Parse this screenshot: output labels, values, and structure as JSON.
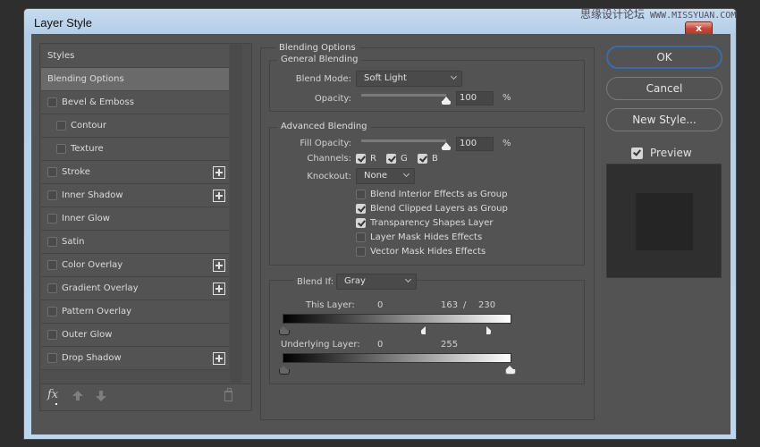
{
  "window": {
    "title": "Layer Style",
    "watermark": "思缘设计论坛",
    "watermark_url": "WWW.MISSYUAN.COM",
    "close_label": "x"
  },
  "styles_list": {
    "items": [
      {
        "label": "Styles",
        "checkbox": false,
        "checked": false,
        "indent": false,
        "plus": false,
        "selected": false
      },
      {
        "label": "Blending Options",
        "checkbox": false,
        "checked": false,
        "indent": false,
        "plus": false,
        "selected": true
      },
      {
        "label": "Bevel & Emboss",
        "checkbox": true,
        "checked": false,
        "indent": false,
        "plus": false,
        "selected": false
      },
      {
        "label": "Contour",
        "checkbox": true,
        "checked": false,
        "indent": true,
        "plus": false,
        "selected": false
      },
      {
        "label": "Texture",
        "checkbox": true,
        "checked": false,
        "indent": true,
        "plus": false,
        "selected": false
      },
      {
        "label": "Stroke",
        "checkbox": true,
        "checked": false,
        "indent": false,
        "plus": true,
        "selected": false
      },
      {
        "label": "Inner Shadow",
        "checkbox": true,
        "checked": false,
        "indent": false,
        "plus": true,
        "selected": false
      },
      {
        "label": "Inner Glow",
        "checkbox": true,
        "checked": false,
        "indent": false,
        "plus": false,
        "selected": false
      },
      {
        "label": "Satin",
        "checkbox": true,
        "checked": false,
        "indent": false,
        "plus": false,
        "selected": false
      },
      {
        "label": "Color Overlay",
        "checkbox": true,
        "checked": false,
        "indent": false,
        "plus": true,
        "selected": false
      },
      {
        "label": "Gradient Overlay",
        "checkbox": true,
        "checked": false,
        "indent": false,
        "plus": true,
        "selected": false
      },
      {
        "label": "Pattern Overlay",
        "checkbox": true,
        "checked": false,
        "indent": false,
        "plus": false,
        "selected": false
      },
      {
        "label": "Outer Glow",
        "checkbox": true,
        "checked": false,
        "indent": false,
        "plus": false,
        "selected": false
      },
      {
        "label": "Drop Shadow",
        "checkbox": true,
        "checked": false,
        "indent": false,
        "plus": true,
        "selected": false
      }
    ],
    "footer": {
      "fx_label": "fx"
    }
  },
  "blending_options": {
    "title": "Blending Options",
    "general": {
      "title": "General Blending",
      "blend_mode_label": "Blend Mode:",
      "blend_mode_value": "Soft Light",
      "opacity_label": "Opacity:",
      "opacity_value": "100",
      "opacity_percent": 100,
      "unit": "%"
    },
    "advanced": {
      "title": "Advanced Blending",
      "fill_opacity_label": "Fill Opacity:",
      "fill_opacity_value": "100",
      "fill_opacity_percent": 100,
      "unit": "%",
      "channels_label": "Channels:",
      "channels": [
        {
          "label": "R",
          "checked": true
        },
        {
          "label": "G",
          "checked": true
        },
        {
          "label": "B",
          "checked": true
        }
      ],
      "knockout_label": "Knockout:",
      "knockout_value": "None",
      "options": [
        {
          "label": "Blend Interior Effects as Group",
          "checked": false
        },
        {
          "label": "Blend Clipped Layers as Group",
          "checked": true
        },
        {
          "label": "Transparency Shapes Layer",
          "checked": true
        },
        {
          "label": "Layer Mask Hides Effects",
          "checked": false
        },
        {
          "label": "Vector Mask Hides Effects",
          "checked": false
        }
      ]
    },
    "blend_if": {
      "label": "Blend If:",
      "value": "Gray",
      "this_layer": {
        "label": "This Layer:",
        "low": "0",
        "high_split_a": "163",
        "separator": "/",
        "high_split_b": "230"
      },
      "underlying_layer": {
        "label": "Underlying Layer:",
        "low": "0",
        "high": "255"
      }
    }
  },
  "actions": {
    "ok": "OK",
    "cancel": "Cancel",
    "new_style": "New Style...",
    "preview_label": "Preview",
    "preview_checked": true
  }
}
